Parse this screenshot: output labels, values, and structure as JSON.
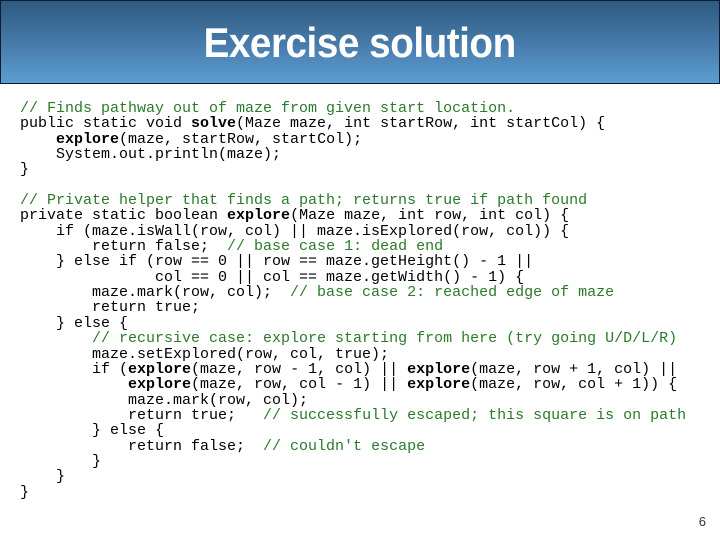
{
  "slide": {
    "title": "Exercise solution",
    "page_number": "6",
    "colors": {
      "header_top": "#2d5a80",
      "header_bottom": "#5d9dd2",
      "comment": "#2a7a2a",
      "code": "#000000"
    }
  },
  "code_lines": [
    [
      {
        "t": "// Finds pathway out of maze from given start location.",
        "s": "cm"
      }
    ],
    [
      {
        "t": "public static void ",
        "s": ""
      },
      {
        "t": "solve",
        "s": "kw"
      },
      {
        "t": "(Maze maze, int startRow, int startCol) {",
        "s": ""
      }
    ],
    [
      {
        "t": "    ",
        "s": ""
      },
      {
        "t": "explore",
        "s": "kw"
      },
      {
        "t": "(maze, startRow, startCol);",
        "s": ""
      }
    ],
    [
      {
        "t": "    System.out.println(maze);",
        "s": ""
      }
    ],
    [
      {
        "t": "}",
        "s": ""
      }
    ],
    [
      {
        "t": "",
        "s": ""
      }
    ],
    [
      {
        "t": "// Private helper that finds a path; returns true if path found",
        "s": "cm"
      }
    ],
    [
      {
        "t": "private static boolean ",
        "s": ""
      },
      {
        "t": "explore",
        "s": "kw"
      },
      {
        "t": "(Maze maze, int row, int col) {",
        "s": ""
      }
    ],
    [
      {
        "t": "    if (maze.isWall(row, col) || maze.isExplored(row, col)) {",
        "s": ""
      }
    ],
    [
      {
        "t": "        return false;  ",
        "s": ""
      },
      {
        "t": "// base case 1: dead end",
        "s": "cm"
      }
    ],
    [
      {
        "t": "    } else if (row == 0 || row == maze.getHeight() - 1 ||",
        "s": ""
      }
    ],
    [
      {
        "t": "               col == 0 || col == maze.getWidth() - 1) {",
        "s": ""
      }
    ],
    [
      {
        "t": "        maze.mark(row, col);  ",
        "s": ""
      },
      {
        "t": "// base case 2: reached edge of maze",
        "s": "cm"
      }
    ],
    [
      {
        "t": "        return true;",
        "s": ""
      }
    ],
    [
      {
        "t": "    } else {",
        "s": ""
      }
    ],
    [
      {
        "t": "        ",
        "s": ""
      },
      {
        "t": "// recursive case: explore starting from here (try going U/D/L/R)",
        "s": "cm"
      }
    ],
    [
      {
        "t": "        maze.setExplored(row, col, true);",
        "s": ""
      }
    ],
    [
      {
        "t": "        if (",
        "s": ""
      },
      {
        "t": "explore",
        "s": "kw"
      },
      {
        "t": "(maze, row - 1, col) || ",
        "s": ""
      },
      {
        "t": "explore",
        "s": "kw"
      },
      {
        "t": "(maze, row + 1, col) ||",
        "s": ""
      }
    ],
    [
      {
        "t": "            ",
        "s": ""
      },
      {
        "t": "explore",
        "s": "kw"
      },
      {
        "t": "(maze, row, col - 1) || ",
        "s": ""
      },
      {
        "t": "explore",
        "s": "kw"
      },
      {
        "t": "(maze, row, col + 1)) {",
        "s": ""
      }
    ],
    [
      {
        "t": "            maze.mark(row, col);",
        "s": ""
      }
    ],
    [
      {
        "t": "            return true;   ",
        "s": ""
      },
      {
        "t": "// successfully escaped; this square is on path",
        "s": "cm"
      }
    ],
    [
      {
        "t": "        } else {",
        "s": ""
      }
    ],
    [
      {
        "t": "            return false;  ",
        "s": ""
      },
      {
        "t": "// couldn't escape",
        "s": "cm"
      }
    ],
    [
      {
        "t": "        }",
        "s": ""
      }
    ],
    [
      {
        "t": "    }",
        "s": ""
      }
    ],
    [
      {
        "t": "}",
        "s": ""
      }
    ]
  ]
}
